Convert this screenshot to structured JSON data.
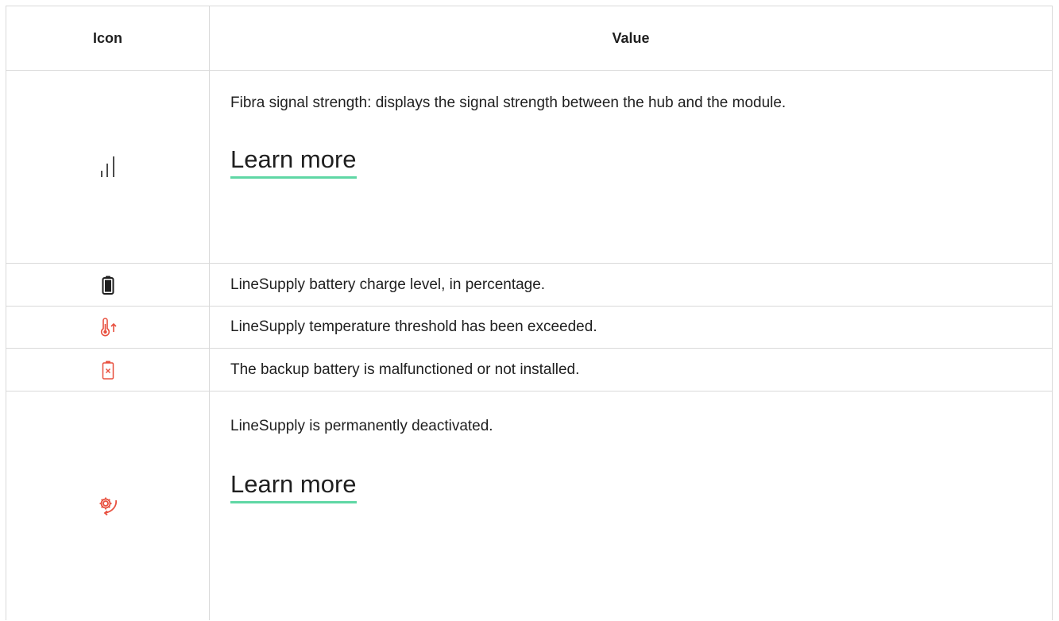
{
  "table": {
    "header": {
      "icon_col": "Icon",
      "value_col": "Value"
    },
    "rows": [
      {
        "icon": "signal-strength-icon",
        "text": "Fibra signal strength: displays the signal strength between the hub and the module.",
        "link": "Learn more"
      },
      {
        "icon": "battery-icon",
        "text": "LineSupply battery charge level, in percentage."
      },
      {
        "icon": "temperature-high-icon",
        "text": "LineSupply temperature threshold has been exceeded."
      },
      {
        "icon": "battery-error-icon",
        "text": "The backup battery is malfunctioned or not installed."
      },
      {
        "icon": "deactivated-gear-icon",
        "text": "LineSupply is permanently deactivated.",
        "link": "Learn more"
      }
    ]
  },
  "colors": {
    "border": "#d9d9d9",
    "link_underline": "#5fd7a5",
    "icon_alert": "#e8503f",
    "icon_default": "#1f1f1f"
  }
}
